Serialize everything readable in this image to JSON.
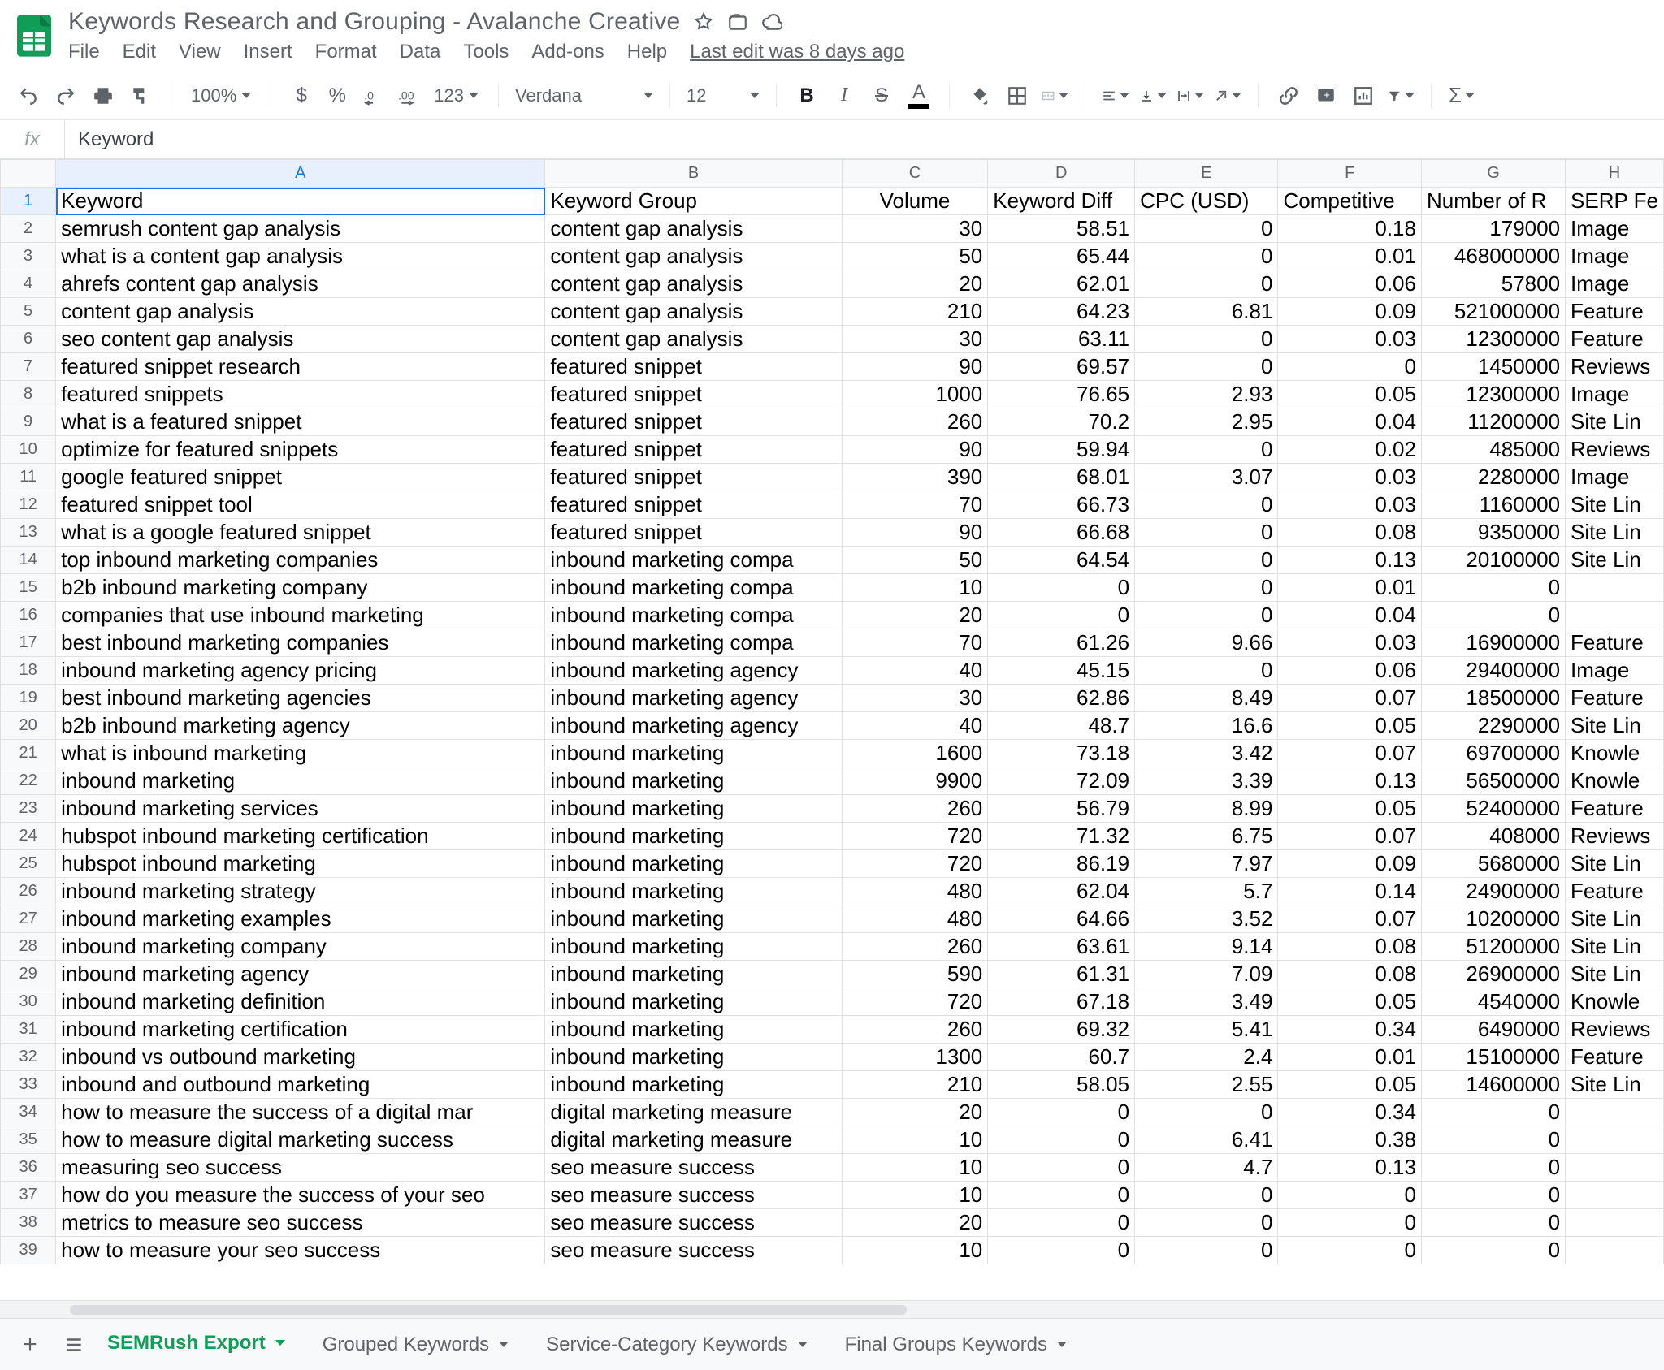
{
  "doc": {
    "title": "Keywords Research and Grouping - Avalanche Creative",
    "last_edit": "Last edit was 8 days ago"
  },
  "menus": [
    "File",
    "Edit",
    "View",
    "Insert",
    "Format",
    "Data",
    "Tools",
    "Add-ons",
    "Help"
  ],
  "toolbar": {
    "zoom": "100%",
    "font": "Verdana",
    "size": "12",
    "format_menu": "123"
  },
  "fx": {
    "value": "Keyword"
  },
  "columns": [
    "A",
    "B",
    "C",
    "D",
    "E",
    "F",
    "G",
    "H"
  ],
  "headers": [
    "Keyword",
    "Keyword Group",
    "Volume",
    "Keyword Diff",
    "CPC (USD)",
    "Competitive",
    "Number of R",
    "SERP Fe"
  ],
  "rows": [
    {
      "n": 2,
      "a": "semrush content gap analysis",
      "b": "content gap analysis",
      "c": "30",
      "d": "58.51",
      "e": "0",
      "f": "0.18",
      "g": "179000",
      "h": "Image"
    },
    {
      "n": 3,
      "a": "what is a content gap analysis",
      "b": "content gap analysis",
      "c": "50",
      "d": "65.44",
      "e": "0",
      "f": "0.01",
      "g": "468000000",
      "h": "Image"
    },
    {
      "n": 4,
      "a": "ahrefs content gap analysis",
      "b": "content gap analysis",
      "c": "20",
      "d": "62.01",
      "e": "0",
      "f": "0.06",
      "g": "57800",
      "h": "Image"
    },
    {
      "n": 5,
      "a": "content gap analysis",
      "b": "content gap analysis",
      "c": "210",
      "d": "64.23",
      "e": "6.81",
      "f": "0.09",
      "g": "521000000",
      "h": "Feature"
    },
    {
      "n": 6,
      "a": "seo content gap analysis",
      "b": "content gap analysis",
      "c": "30",
      "d": "63.11",
      "e": "0",
      "f": "0.03",
      "g": "12300000",
      "h": "Feature"
    },
    {
      "n": 7,
      "a": "featured snippet research",
      "b": "featured snippet",
      "c": "90",
      "d": "69.57",
      "e": "0",
      "f": "0",
      "g": "1450000",
      "h": "Reviews"
    },
    {
      "n": 8,
      "a": "featured snippets",
      "b": "featured snippet",
      "c": "1000",
      "d": "76.65",
      "e": "2.93",
      "f": "0.05",
      "g": "12300000",
      "h": "Image"
    },
    {
      "n": 9,
      "a": "what is a featured snippet",
      "b": "featured snippet",
      "c": "260",
      "d": "70.2",
      "e": "2.95",
      "f": "0.04",
      "g": "11200000",
      "h": "Site Lin"
    },
    {
      "n": 10,
      "a": "optimize for featured snippets",
      "b": "featured snippet",
      "c": "90",
      "d": "59.94",
      "e": "0",
      "f": "0.02",
      "g": "485000",
      "h": "Reviews"
    },
    {
      "n": 11,
      "a": "google featured snippet",
      "b": "featured snippet",
      "c": "390",
      "d": "68.01",
      "e": "3.07",
      "f": "0.03",
      "g": "2280000",
      "h": "Image"
    },
    {
      "n": 12,
      "a": "featured snippet tool",
      "b": "featured snippet",
      "c": "70",
      "d": "66.73",
      "e": "0",
      "f": "0.03",
      "g": "1160000",
      "h": "Site Lin"
    },
    {
      "n": 13,
      "a": "what is a google featured snippet",
      "b": "featured snippet",
      "c": "90",
      "d": "66.68",
      "e": "0",
      "f": "0.08",
      "g": "9350000",
      "h": "Site Lin"
    },
    {
      "n": 14,
      "a": "top inbound marketing companies",
      "b": "inbound marketing compa",
      "c": "50",
      "d": "64.54",
      "e": "0",
      "f": "0.13",
      "g": "20100000",
      "h": "Site Lin"
    },
    {
      "n": 15,
      "a": "b2b inbound marketing company",
      "b": "inbound marketing compa",
      "c": "10",
      "d": "0",
      "e": "0",
      "f": "0.01",
      "g": "0",
      "h": ""
    },
    {
      "n": 16,
      "a": "companies that use inbound marketing",
      "b": "inbound marketing compa",
      "c": "20",
      "d": "0",
      "e": "0",
      "f": "0.04",
      "g": "0",
      "h": ""
    },
    {
      "n": 17,
      "a": "best inbound marketing companies",
      "b": "inbound marketing compa",
      "c": "70",
      "d": "61.26",
      "e": "9.66",
      "f": "0.03",
      "g": "16900000",
      "h": "Feature"
    },
    {
      "n": 18,
      "a": "inbound marketing agency pricing",
      "b": "inbound marketing agency",
      "c": "40",
      "d": "45.15",
      "e": "0",
      "f": "0.06",
      "g": "29400000",
      "h": "Image"
    },
    {
      "n": 19,
      "a": "best inbound marketing agencies",
      "b": "inbound marketing agency",
      "c": "30",
      "d": "62.86",
      "e": "8.49",
      "f": "0.07",
      "g": "18500000",
      "h": "Feature"
    },
    {
      "n": 20,
      "a": "b2b inbound marketing agency",
      "b": "inbound marketing agency",
      "c": "40",
      "d": "48.7",
      "e": "16.6",
      "f": "0.05",
      "g": "2290000",
      "h": "Site Lin"
    },
    {
      "n": 21,
      "a": "what is inbound marketing",
      "b": "inbound marketing",
      "c": "1600",
      "d": "73.18",
      "e": "3.42",
      "f": "0.07",
      "g": "69700000",
      "h": "Knowle"
    },
    {
      "n": 22,
      "a": "inbound marketing",
      "b": "inbound marketing",
      "c": "9900",
      "d": "72.09",
      "e": "3.39",
      "f": "0.13",
      "g": "56500000",
      "h": "Knowle"
    },
    {
      "n": 23,
      "a": "inbound marketing services",
      "b": "inbound marketing",
      "c": "260",
      "d": "56.79",
      "e": "8.99",
      "f": "0.05",
      "g": "52400000",
      "h": "Feature"
    },
    {
      "n": 24,
      "a": "hubspot inbound marketing certification",
      "b": "inbound marketing",
      "c": "720",
      "d": "71.32",
      "e": "6.75",
      "f": "0.07",
      "g": "408000",
      "h": "Reviews"
    },
    {
      "n": 25,
      "a": "hubspot inbound marketing",
      "b": "inbound marketing",
      "c": "720",
      "d": "86.19",
      "e": "7.97",
      "f": "0.09",
      "g": "5680000",
      "h": "Site Lin"
    },
    {
      "n": 26,
      "a": "inbound marketing strategy",
      "b": "inbound marketing",
      "c": "480",
      "d": "62.04",
      "e": "5.7",
      "f": "0.14",
      "g": "24900000",
      "h": "Feature"
    },
    {
      "n": 27,
      "a": "inbound marketing examples",
      "b": "inbound marketing",
      "c": "480",
      "d": "64.66",
      "e": "3.52",
      "f": "0.07",
      "g": "10200000",
      "h": "Site Lin"
    },
    {
      "n": 28,
      "a": "inbound marketing company",
      "b": "inbound marketing",
      "c": "260",
      "d": "63.61",
      "e": "9.14",
      "f": "0.08",
      "g": "51200000",
      "h": "Site Lin"
    },
    {
      "n": 29,
      "a": "inbound marketing agency",
      "b": "inbound marketing",
      "c": "590",
      "d": "61.31",
      "e": "7.09",
      "f": "0.08",
      "g": "26900000",
      "h": "Site Lin"
    },
    {
      "n": 30,
      "a": "inbound marketing definition",
      "b": "inbound marketing",
      "c": "720",
      "d": "67.18",
      "e": "3.49",
      "f": "0.05",
      "g": "4540000",
      "h": "Knowle"
    },
    {
      "n": 31,
      "a": "inbound marketing certification",
      "b": "inbound marketing",
      "c": "260",
      "d": "69.32",
      "e": "5.41",
      "f": "0.34",
      "g": "6490000",
      "h": "Reviews"
    },
    {
      "n": 32,
      "a": "inbound vs outbound marketing",
      "b": "inbound marketing",
      "c": "1300",
      "d": "60.7",
      "e": "2.4",
      "f": "0.01",
      "g": "15100000",
      "h": "Feature"
    },
    {
      "n": 33,
      "a": "inbound and outbound marketing",
      "b": "inbound marketing",
      "c": "210",
      "d": "58.05",
      "e": "2.55",
      "f": "0.05",
      "g": "14600000",
      "h": "Site Lin"
    },
    {
      "n": 34,
      "a": "how to measure the success of a digital mar",
      "b": "digital marketing measure",
      "c": "20",
      "d": "0",
      "e": "0",
      "f": "0.34",
      "g": "0",
      "h": ""
    },
    {
      "n": 35,
      "a": "how to measure digital marketing success",
      "b": "digital marketing measure",
      "c": "10",
      "d": "0",
      "e": "6.41",
      "f": "0.38",
      "g": "0",
      "h": ""
    },
    {
      "n": 36,
      "a": "measuring seo success",
      "b": "seo measure success",
      "c": "10",
      "d": "0",
      "e": "4.7",
      "f": "0.13",
      "g": "0",
      "h": ""
    },
    {
      "n": 37,
      "a": "how do you measure the success of your seo",
      "b": "seo measure success",
      "c": "10",
      "d": "0",
      "e": "0",
      "f": "0",
      "g": "0",
      "h": ""
    },
    {
      "n": 38,
      "a": "metrics to measure seo success",
      "b": "seo measure success",
      "c": "20",
      "d": "0",
      "e": "0",
      "f": "0",
      "g": "0",
      "h": ""
    },
    {
      "n": 39,
      "a": "how to measure your seo success",
      "b": "seo measure success",
      "c": "10",
      "d": "0",
      "e": "0",
      "f": "0",
      "g": "0",
      "h": ""
    }
  ],
  "tabs": [
    {
      "label": "SEMRush Export",
      "active": true
    },
    {
      "label": "Grouped Keywords",
      "active": false
    },
    {
      "label": "Service-Category Keywords",
      "active": false
    },
    {
      "label": "Final Groups Keywords",
      "active": false
    }
  ]
}
